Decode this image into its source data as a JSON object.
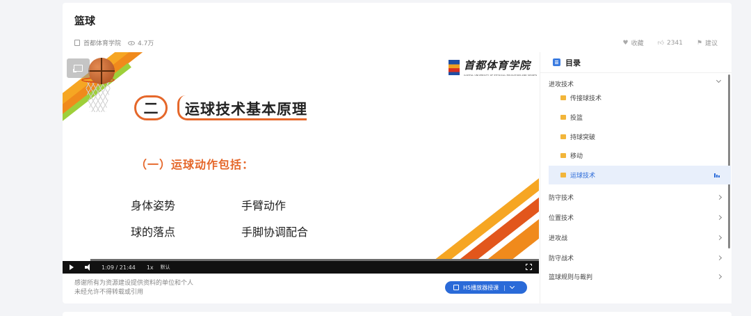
{
  "header": {
    "title": "篮球",
    "publisher": "首都体育学院",
    "views": "4.7万",
    "favorite_label": "收藏",
    "like_count": "2341",
    "suggest_label": "建议"
  },
  "slide": {
    "logo_cn": "首都体育学院",
    "logo_en": "CAPITAL UNIVERSITY OF PHYSICAL EDUCATION AND SPORTS",
    "heading_num": "二",
    "heading_text": "运球技术基本原理",
    "sub_heading": "（一）运球动作包括：",
    "items": [
      "身体姿势",
      "手臂动作",
      "球的落点",
      "手脚协调配合"
    ]
  },
  "player": {
    "current_time": "1:09",
    "separator": "/",
    "duration": "21:44",
    "progress_fraction": 0.053,
    "speed": "1x",
    "quality": "默认"
  },
  "footer": {
    "notice_line1": "感谢所有为资源建设提供资料的单位和个人",
    "notice_line2": "未经允许不得转载或引用",
    "h5_button": "H5播放器授课",
    "h5_sep": "|"
  },
  "catalog": {
    "title": "目录",
    "sections": [
      {
        "label": "进攻技术",
        "expanded": true,
        "lessons": [
          "传接球技术",
          "投篮",
          "持球突破",
          "移动",
          "运球技术"
        ]
      },
      {
        "label": "防守技术",
        "expanded": false
      },
      {
        "label": "位置技术",
        "expanded": false
      },
      {
        "label": "进攻战",
        "expanded": false
      },
      {
        "label": "防守战术",
        "expanded": false
      },
      {
        "label": "篮球规则与裁判",
        "expanded": false
      }
    ],
    "active_lesson": "运球技术"
  },
  "colors": {
    "accent": "#2a6ad8",
    "slide_orange": "#e5672a",
    "stripe_yellow": "#f6a623",
    "stripe_green": "#9ecf3a"
  }
}
